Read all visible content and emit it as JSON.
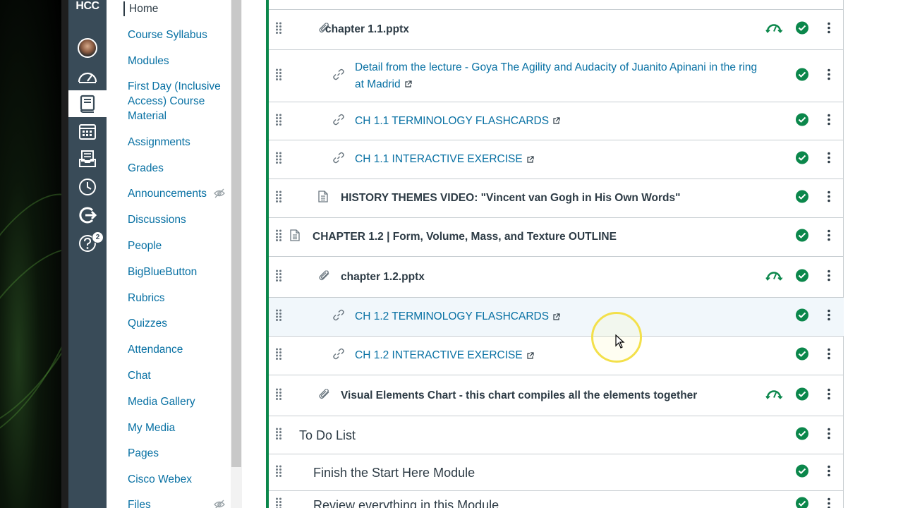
{
  "logo": {
    "text": "HCC"
  },
  "global_nav": {
    "items": [
      {
        "name": "account",
        "icon": "avatar"
      },
      {
        "name": "dashboard",
        "icon": "dashboard-icon"
      },
      {
        "name": "courses",
        "icon": "courses-icon",
        "active": true
      },
      {
        "name": "calendar",
        "icon": "calendar-icon"
      },
      {
        "name": "inbox",
        "icon": "inbox-icon"
      },
      {
        "name": "history",
        "icon": "history-icon"
      },
      {
        "name": "commons",
        "icon": "commons-icon"
      },
      {
        "name": "help",
        "icon": "help-icon",
        "badge": "2"
      }
    ]
  },
  "course_nav": {
    "items": [
      {
        "label": "Home"
      },
      {
        "label": "Course Syllabus"
      },
      {
        "label": "Modules"
      },
      {
        "label": "First Day (Inclusive Access) Course Material"
      },
      {
        "label": "Assignments"
      },
      {
        "label": "Grades"
      },
      {
        "label": "Announcements",
        "hidden": true
      },
      {
        "label": "Discussions"
      },
      {
        "label": "People"
      },
      {
        "label": "BigBlueButton"
      },
      {
        "label": "Rubrics"
      },
      {
        "label": "Quizzes"
      },
      {
        "label": "Attendance"
      },
      {
        "label": "Chat"
      },
      {
        "label": "Media Gallery"
      },
      {
        "label": "My Media"
      },
      {
        "label": "Pages"
      },
      {
        "label": "Cisco Webex"
      },
      {
        "label": "Files",
        "hidden": true
      }
    ]
  },
  "module_items": [
    {
      "title": "chapter 1.1.pptx",
      "type": "attachment",
      "style": "bold",
      "mastery": true
    },
    {
      "title": "Detail from the lecture - Goya The Agility and Audacity of Juanito Apinani in the ring at Madrid",
      "type": "link",
      "style": "link"
    },
    {
      "title": "CH 1.1 TERMINOLOGY FLASHCARDS",
      "type": "link",
      "style": "link"
    },
    {
      "title": "CH 1.1 INTERACTIVE EXERCISE",
      "type": "link",
      "style": "link"
    },
    {
      "title": "HISTORY THEMES VIDEO: \"Vincent van Gogh in His Own Words\"",
      "type": "page",
      "style": "bold"
    },
    {
      "title": "CHAPTER 1.2 | Form, Volume, Mass, and Texture OUTLINE",
      "type": "page",
      "style": "bold"
    },
    {
      "title": "chapter 1.2.pptx",
      "type": "attachment",
      "style": "bold",
      "mastery": true
    },
    {
      "title": "CH 1.2 TERMINOLOGY FLASHCARDS",
      "type": "link",
      "style": "link"
    },
    {
      "title": "CH 1.2 INTERACTIVE EXERCISE",
      "type": "link",
      "style": "link"
    },
    {
      "title": "Visual Elements Chart - this chart compiles all the elements together",
      "type": "attachment",
      "style": "bold",
      "mastery": true
    },
    {
      "title": "To Do List",
      "type": "header",
      "style": "header"
    },
    {
      "title": "Finish the Start Here Module",
      "type": "header",
      "style": "header"
    },
    {
      "title": "Review everything in this Module",
      "type": "header",
      "style": "header"
    }
  ],
  "colors": {
    "accent": "#0770a3",
    "published": "#0b874b",
    "nav_bg": "#394b58",
    "cursor_highlight": "#f3e04a"
  }
}
